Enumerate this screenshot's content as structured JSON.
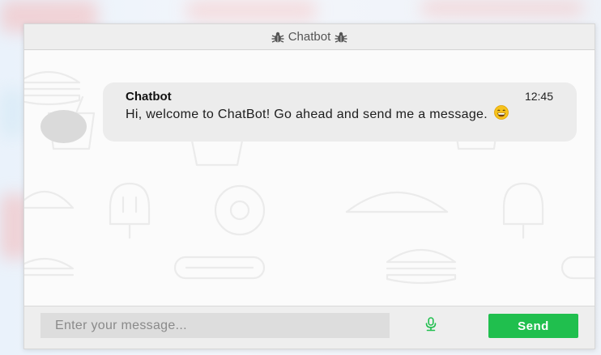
{
  "header": {
    "title": "Chatbot",
    "left_icon": "bug-icon",
    "right_icon": "bug-icon"
  },
  "messages": [
    {
      "sender": "Chatbot",
      "time": "12:45",
      "text": "Hi, welcome to ChatBot! Go ahead and send me a message.",
      "emoji": "grinning-face-emoji"
    }
  ],
  "composer": {
    "placeholder": "Enter your message...",
    "value": "",
    "mic_icon": "microphone-icon",
    "send_label": "Send"
  },
  "colors": {
    "send_button": "#20bf4e",
    "bubble": "#ececec",
    "header": "#eeeeee",
    "avatar": "#dadada",
    "mic": "#20bf4e"
  }
}
